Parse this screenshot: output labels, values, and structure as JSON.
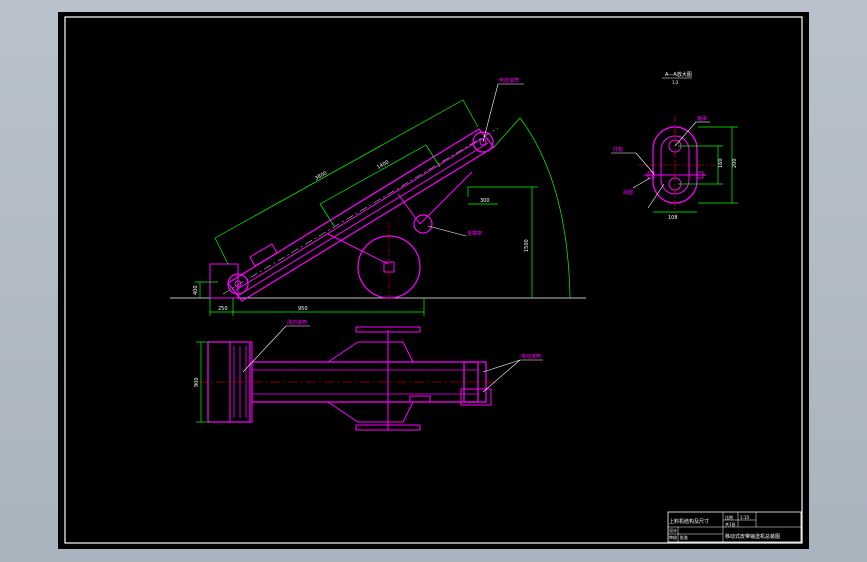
{
  "drawing": {
    "background": "#000000",
    "line_colors": {
      "frame": "#ffffff",
      "outline": "#ff00ff",
      "dimension": "#00ff00",
      "leader": "#ffffff",
      "centerline": "#ff0000"
    }
  },
  "side_view": {
    "dims": {
      "belt_length": "3800",
      "inner_length": "1400",
      "max_height": "1500",
      "base_offset": "250",
      "wheel_span": "950",
      "short_span": "300",
      "left_height": "400"
    },
    "labels": {
      "top_callout": "电动滚筒",
      "mid_callout": "支撑架"
    }
  },
  "section_view": {
    "title": "A—A放大图",
    "title_sub": "1:2",
    "labels": {
      "left_callout": "托辊",
      "mid_callout": "轴承",
      "bottom_callout": "挡圈"
    },
    "dims": {
      "top_width": "108",
      "height": "200",
      "right_height": "160"
    }
  },
  "top_view": {
    "labels": {
      "left_callout": "改向滚筒",
      "right_callout": "电动滚筒"
    },
    "dims": {
      "width": "900"
    }
  },
  "title_block": {
    "product_name": "上料机结构及尺寸",
    "drawing_name": "移动式皮带输送机总装图",
    "scale_label": "比例",
    "scale_value": "1:10",
    "sheet_label": "共1张",
    "design_label": "设计",
    "check_label": "审核",
    "approve_label": "批准"
  }
}
